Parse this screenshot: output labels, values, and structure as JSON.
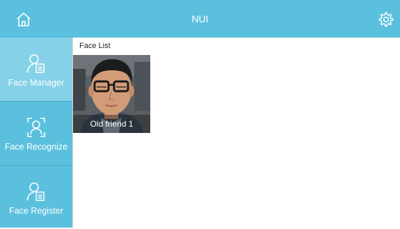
{
  "app": {
    "title": "NUI"
  },
  "topbar": {
    "home_icon": "home-icon",
    "settings_icon": "gear-icon"
  },
  "sidebar": {
    "items": [
      {
        "label": "Face Manager",
        "icon": "user-list-icon",
        "active": true
      },
      {
        "label": "Face Recognize",
        "icon": "face-scan-icon",
        "active": false
      },
      {
        "label": "Face Register",
        "icon": "user-list-icon",
        "active": false
      }
    ]
  },
  "main": {
    "list_title": "Face List",
    "faces": [
      {
        "caption": "Old friend 1"
      }
    ]
  },
  "colors": {
    "accent": "#5bc0de",
    "active": "#84d1e8",
    "text_on_accent": "#ffffff"
  }
}
